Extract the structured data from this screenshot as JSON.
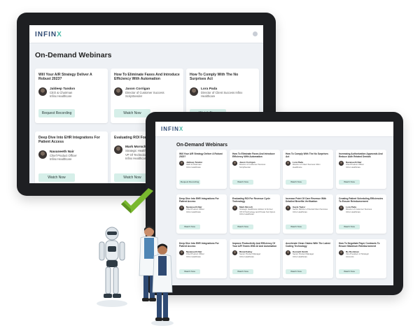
{
  "brand": {
    "logo_main": "INFIN",
    "logo_accent": "X",
    "accent": "#48b8a6",
    "primary": "#2f4a73",
    "button_bg": "#d6efe9"
  },
  "page_title": "On-Demand Webinars",
  "large_tablet": {
    "cards": [
      {
        "title": "Will Your A/R Strategy Deliver A Robust 2023?",
        "name": "Jaldeep Tandon",
        "role": "CEO & Chairman\nInfinx Healthcare",
        "button": "Request Recording"
      },
      {
        "title": "How To Eliminate Faxes And Introduce Efficiency With Automation",
        "name": "Jason Corrigan",
        "role": "Director of Customer Success\nScriptSender",
        "button": "Watch Now"
      },
      {
        "title": "How To Comply With The No Surprises Act",
        "name": "Lora Pada",
        "role": "Director of Client Success Infinx\nHealthcare",
        "button": "Watch Now"
      },
      {
        "title": "Deep Dive Into EHR Integrations For Patient Access",
        "name": "Navaneeth Nair",
        "role": "Chief Product Officer\nInfinx Healthcare",
        "button": "Watch Now"
      },
      {
        "title": "Evaluating ROI For Reve",
        "name": "Mark Morsch",
        "role": "Strategic Healthc\nVP Of Technolog\nInfinx Healthcare",
        "button": "Watch Now"
      }
    ]
  },
  "small_tablet": {
    "cards": [
      {
        "title": "Will Your A/R Strategy Deliver A Robust 2023?",
        "name": "Jaldeep Tandon",
        "role": "CEO & Chairman\nInfinx Healthcare",
        "button": "Request Recording"
      },
      {
        "title": "How To Eliminate Faxes And Introduce Efficiency With Automation",
        "name": "Jason Corrigan",
        "role": "Director of Customer Success\nScriptSender",
        "button": "Watch Now"
      },
      {
        "title": "How To Comply With The No Surprises Act",
        "name": "Lora Pada",
        "role": "Director of Client Success Infinx\nHealthcare",
        "button": "Watch Now"
      },
      {
        "title": "Increasing Authorization Approvals And Reduce Auth Related Denials",
        "name": "Navaneeth Nair",
        "role": "Chief Product Officer\nInfinx Healthcare",
        "button": "Watch Now"
      },
      {
        "title": "Deep Dive Into EHR Integrations For Patient Access",
        "name": "Navaneeth Nair",
        "role": "Chief Product Officer\nInfinx Healthcare",
        "button": "Watch Now"
      },
      {
        "title": "Evaluating ROI For Revenue Cycle Technology",
        "name": "Mark Morsch",
        "role": "Strategic Healthcare Advisor & Former\nVP Of Technology and Private Sol Optum\nInfinx Healthcare",
        "button": "Watch Now"
      },
      {
        "title": "Increase Point Of Care Revenue With Detailed Benefits Verification",
        "name": "Gayle Taylor",
        "role": "Senior Director of Dental Client Services\nInfinx Healthcare",
        "button": "Watch Now"
      },
      {
        "title": "Creating Patient Scheduling Efficiencies To Ensure Reimbursement",
        "name": "Lora Pada",
        "role": "Director of Customer Success\nInfinx Healthcare",
        "button": "Watch Now"
      },
      {
        "title": "Deep Dive Into EHR Integrations For Patient Access",
        "name": "Navaneeth Nair",
        "role": "Chief Product Officer\nInfinx Healthcare",
        "button": "Watch Now"
      },
      {
        "title": "Improve Productivity And Efficiency Of Your A/R Teams With AI And Automation",
        "name": "Bimal Kalley",
        "role": "Senior Product Manager\nInfinx Healthcare",
        "button": "Watch Now"
      },
      {
        "title": "Accelerate Clean Claims With The Latest Coding Technology",
        "name": "Kenneth Smith",
        "role": "Senior Product Manager\nInfinx Healthcare",
        "button": "Watch Now"
      },
      {
        "title": "How To Negotiate Payer Contracts To Ensure Maximum Reimbursement",
        "name": "Bo Bockman",
        "role": "Vice President of Strategic\nAccounts",
        "button": "Watch Now"
      }
    ]
  }
}
